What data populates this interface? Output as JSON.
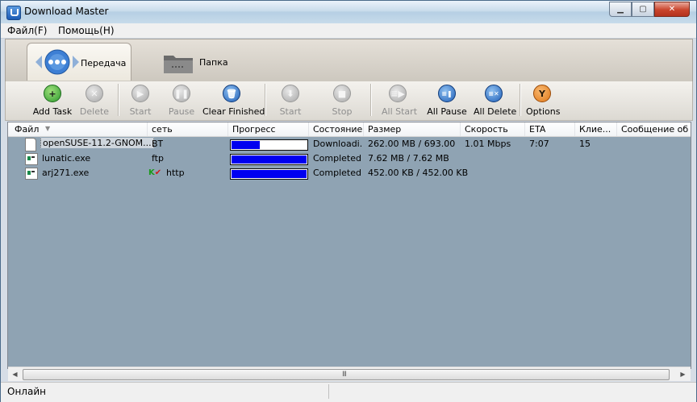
{
  "window": {
    "title": "Download Master"
  },
  "menu": [
    "Файл(F)",
    "Помощь(H)"
  ],
  "tabs": [
    {
      "label": "Передача",
      "icon": "transfer-globe-icon",
      "active": true
    },
    {
      "label": "Папка",
      "icon": "folder-icon",
      "active": false
    }
  ],
  "toolbar": [
    {
      "label": "Add Task",
      "icon": "add-icon",
      "enabled": true,
      "color": "#2e9a2e"
    },
    {
      "label": "Delete",
      "icon": "delete-icon",
      "enabled": false
    },
    {
      "label": "Start",
      "icon": "start-icon",
      "enabled": false
    },
    {
      "label": "Pause",
      "icon": "pause-icon",
      "enabled": false
    },
    {
      "label": "Clear Finished",
      "icon": "trash-icon",
      "enabled": true,
      "color": "#1f5fb8"
    },
    {
      "label": "Start",
      "icon": "start-scheduled-icon",
      "enabled": false
    },
    {
      "label": "Stop",
      "icon": "stop-icon",
      "enabled": false
    },
    {
      "label": "All Start",
      "icon": "all-start-icon",
      "enabled": false
    },
    {
      "label": "All Pause",
      "icon": "all-pause-icon",
      "enabled": true,
      "color": "#1f5fb8"
    },
    {
      "label": "All Delete",
      "icon": "all-delete-icon",
      "enabled": true,
      "color": "#1f5fb8"
    },
    {
      "label": "Options",
      "icon": "options-icon",
      "enabled": true,
      "color": "#e07818"
    }
  ],
  "columns": [
    "Файл",
    "сеть",
    "Прогресс",
    "Состояние",
    "Размер",
    "Скорость",
    "ETA",
    "Клие...",
    "Сообщение об ..."
  ],
  "rows": [
    {
      "file": "openSUSE-11.2-GNOM...",
      "net": "BT",
      "progress": 0.378,
      "status": "Downloadi...",
      "size": "262.00 MB / 693.00 ...",
      "speed": "1.01 Mbps",
      "eta": "7:07",
      "clients": "15",
      "message": ""
    },
    {
      "file": "lunatic.exe",
      "net": "ftp",
      "progress": 1.0,
      "status": "Completed",
      "size": "7.62 MB / 7.62 MB",
      "speed": "",
      "eta": "",
      "clients": "",
      "message": ""
    },
    {
      "file": "arj271.exe",
      "net": "http",
      "progress": 1.0,
      "status": "Completed",
      "size": "452.00 KB / 452.00 KB",
      "speed": "",
      "eta": "",
      "clients": "",
      "message": ""
    }
  ],
  "status": {
    "text": "Онлайн"
  },
  "colors": {
    "list_bg": "#8fa3b3",
    "progress_fill": "#0000f0",
    "options_orange": "#e07818"
  }
}
